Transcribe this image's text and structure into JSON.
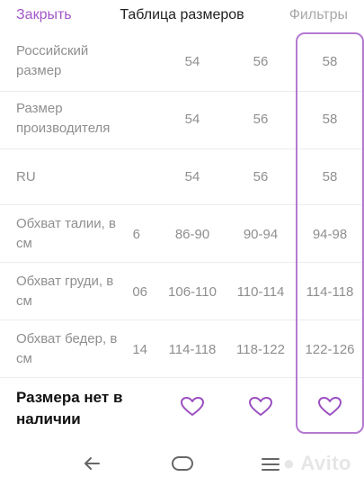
{
  "header": {
    "close_label": "Закрыть",
    "title": "Таблица размеров",
    "filters_label": "Фильтры"
  },
  "rows": [
    {
      "label": "Российский размер",
      "partial": "",
      "values": [
        "54",
        "56",
        "58"
      ]
    },
    {
      "label": "Размер производителя",
      "partial": "",
      "values": [
        "54",
        "56",
        "58"
      ]
    },
    {
      "label": "RU",
      "partial": "",
      "values": [
        "54",
        "56",
        "58"
      ]
    },
    {
      "label": "Обхват талии, в см",
      "partial": "6",
      "values": [
        "86-90",
        "90-94",
        "94-98"
      ]
    },
    {
      "label": "Обхват груди, в см",
      "partial": "06",
      "values": [
        "106-110",
        "110-114",
        "114-118"
      ]
    },
    {
      "label": "Обхват бедер, в см",
      "partial": "14",
      "values": [
        "114-118",
        "118-122",
        "122-126"
      ]
    }
  ],
  "availability": {
    "label": "Размера нет в наличии"
  },
  "icons": {
    "heart": "heart-icon",
    "back": "back-arrow-icon",
    "home": "home-icon",
    "menu": "menu-icon"
  },
  "colors": {
    "accent": "#a357c8",
    "highlight_border": "#b57ad2",
    "heart": "#9b4fc0"
  },
  "watermark": "Avito"
}
